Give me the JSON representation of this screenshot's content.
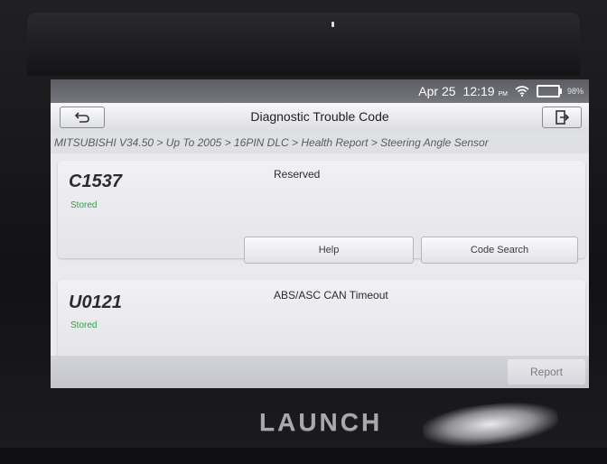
{
  "status_bar": {
    "date": "Apr 25",
    "time": "12:19",
    "ampm": "PM",
    "battery": "98%"
  },
  "header": {
    "title": "Diagnostic Trouble Code"
  },
  "breadcrumb": "MITSUBISHI V34.50 > Up To 2005 > 16PIN DLC > Health Report > Steering Angle Sensor",
  "dtcs": [
    {
      "code": "C1537",
      "status": "Stored",
      "description": "Reserved"
    },
    {
      "code": "U0121",
      "status": "Stored",
      "description": "ABS/ASC CAN Timeout"
    }
  ],
  "buttons": {
    "help": "Help",
    "code_search": "Code Search",
    "report": "Report"
  },
  "device": {
    "brand": "LAUNCH"
  },
  "colors": {
    "status_green": "#2e9f47",
    "statusbar_bg": "#6a6b70"
  },
  "icons": {
    "back": "back-arrow-icon",
    "exit": "exit-icon",
    "wifi": "wifi-icon",
    "battery": "battery-icon"
  }
}
